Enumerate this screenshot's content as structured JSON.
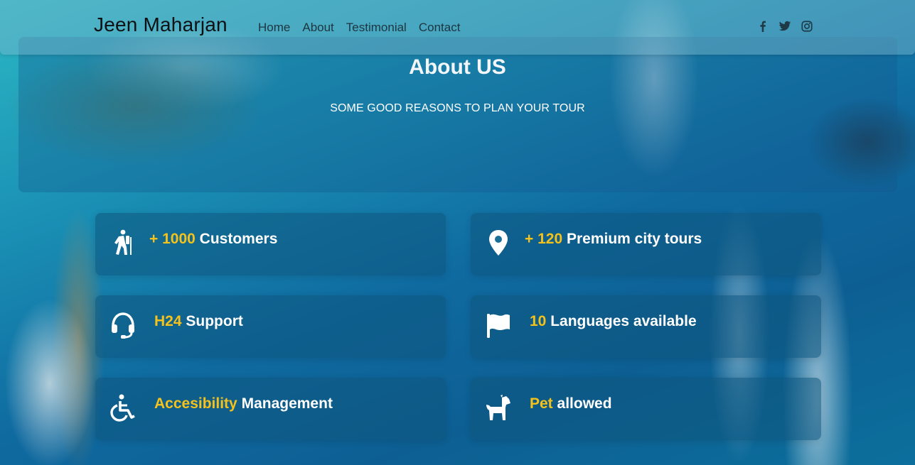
{
  "navbar": {
    "brand": "Jeen Maharjan",
    "links": [
      "Home",
      "About",
      "Testimonial",
      "Contact"
    ],
    "social_icons": [
      "facebook-icon",
      "twitter-icon",
      "instagram-icon"
    ]
  },
  "about": {
    "title": "About US",
    "subtitle": "SOME GOOD REASONS TO PLAN YOUR TOUR"
  },
  "features": [
    {
      "highlight": "+ 1000",
      "label": "Customers",
      "icon": "hiker-icon"
    },
    {
      "highlight": "+ 120",
      "label": "Premium city tours",
      "icon": "map-pin-icon"
    },
    {
      "highlight": "H24",
      "label": "Support",
      "icon": "headset-icon"
    },
    {
      "highlight": "10",
      "label": "Languages available",
      "icon": "flag-icon"
    },
    {
      "highlight": "Accesibility",
      "label": "Management",
      "icon": "wheelchair-icon"
    },
    {
      "highlight": "Pet",
      "label": "allowed",
      "icon": "dog-icon"
    }
  ],
  "colors": {
    "accent": "#f4c21b",
    "text": "#ffffff"
  }
}
